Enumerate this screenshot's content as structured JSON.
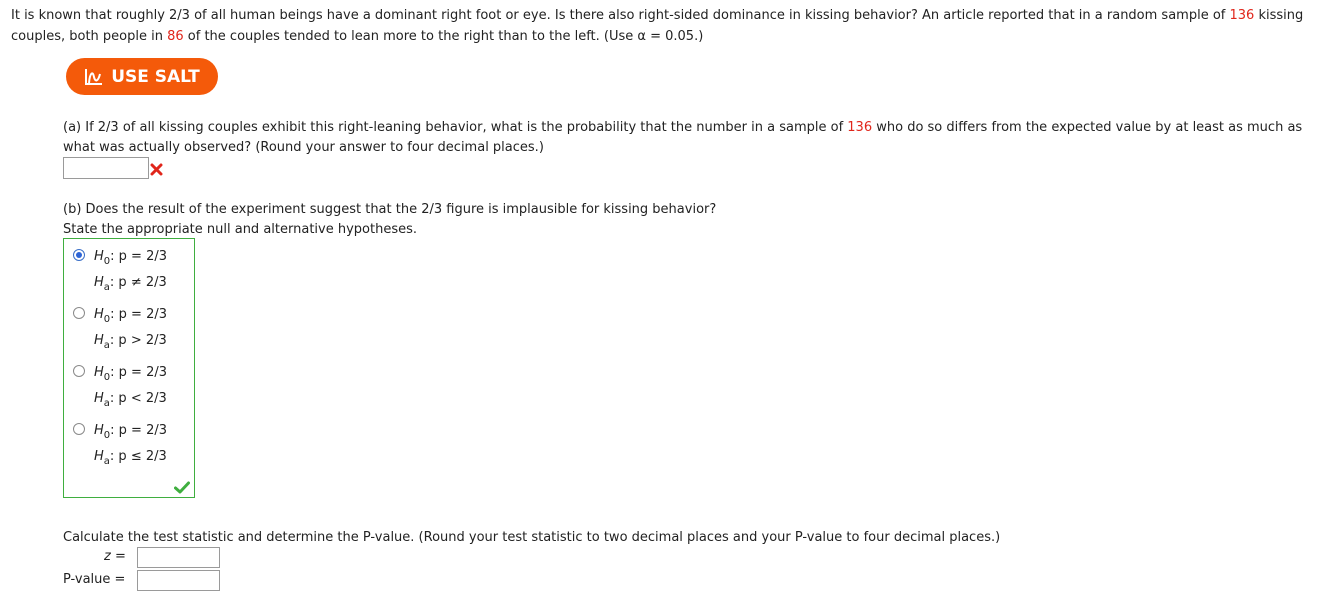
{
  "intro": {
    "text_1": "It is known that roughly 2/3 of all human beings have a dominant right foot or eye. Is there also right-sided dominance in kissing behavior? An article reported that in a random sample of ",
    "sample_size": "136",
    "text_2": " kissing couples, both people in ",
    "count": "86",
    "text_3": " of the couples tended to lean more to the right than to the left. (Use α = 0.05.)"
  },
  "salt_button": {
    "label": "USE SALT",
    "color": "#f45a0a"
  },
  "part_a": {
    "text_1": "(a) If 2/3 of all kissing couples exhibit this right-leaning behavior, what is the probability that the number in a sample of ",
    "sample_size": "136",
    "text_2": " who do so differs from the expected value by at least as much as what was actually observed? (Round your answer to four decimal places.)",
    "answer_value": "",
    "status_icon": "incorrect-x-icon"
  },
  "part_b": {
    "question": "(b) Does the result of the experiment suggest that the 2/3 figure is implausible for kissing behavior?",
    "instruction": "State the appropriate null and alternative hypotheses.",
    "options": [
      {
        "h0_label": "H",
        "h0_sub": "0",
        "h0_rest": ": p = 2/3",
        "ha_label": "H",
        "ha_sub": "a",
        "ha_rest": ": p ≠ 2/3",
        "selected": true
      },
      {
        "h0_label": "H",
        "h0_sub": "0",
        "h0_rest": ": p = 2/3",
        "ha_label": "H",
        "ha_sub": "a",
        "ha_rest": ": p > 2/3",
        "selected": false
      },
      {
        "h0_label": "H",
        "h0_sub": "0",
        "h0_rest": ": p = 2/3",
        "ha_label": "H",
        "ha_sub": "a",
        "ha_rest": ": p < 2/3",
        "selected": false
      },
      {
        "h0_label": "H",
        "h0_sub": "0",
        "h0_rest": ": p = 2/3",
        "ha_label": "H",
        "ha_sub": "a",
        "ha_rest": ": p ≤ 2/3",
        "selected": false
      }
    ],
    "status_icon": "correct-check-icon"
  },
  "calc": {
    "instruction": "Calculate the test statistic and determine the P-value. (Round your test statistic to two decimal places and your P-value to four decimal places.)",
    "z_label": "z =",
    "z_value": "",
    "p_label": "P-value =",
    "p_value": ""
  },
  "colors": {
    "highlight": "#e0261b",
    "correct": "#3fae3f",
    "incorrect": "#e0261b",
    "radio_selected": "#2e65d6"
  }
}
